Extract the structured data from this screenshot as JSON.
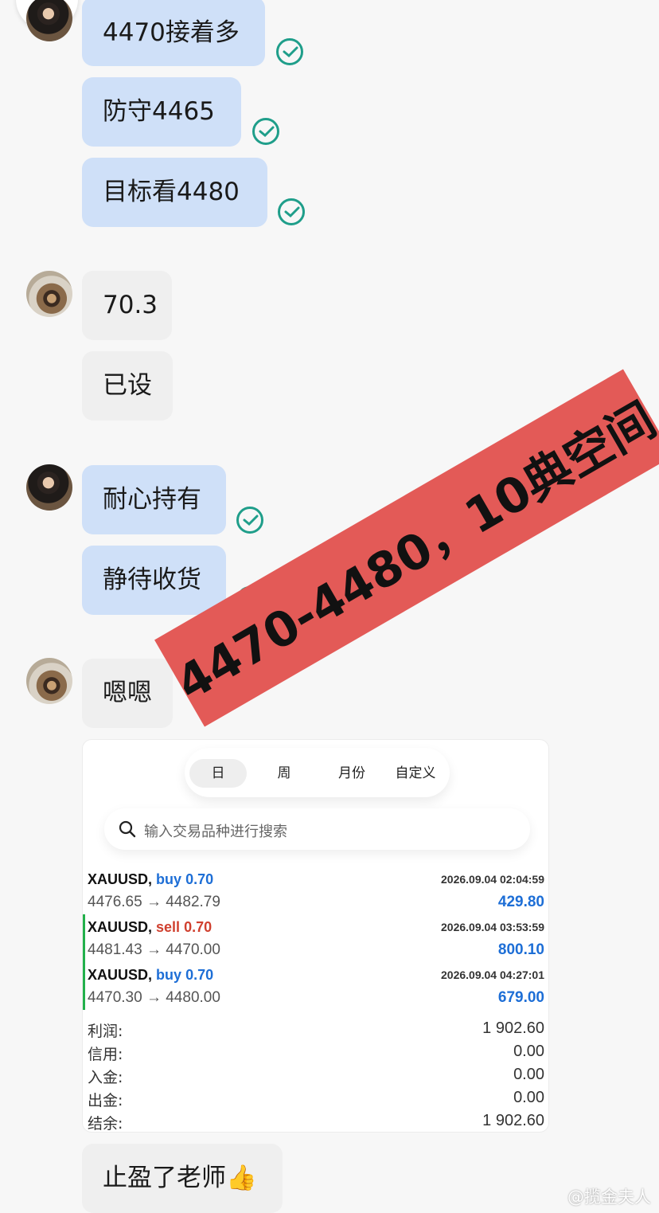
{
  "messages": {
    "m1": "4470接着多",
    "m2": "防守4465",
    "m3": "目标看4480",
    "m4": "70.3",
    "m5": "已设",
    "m6": "耐心持有",
    "m7": "静待收货",
    "m8": "嗯嗯",
    "m9": "止盈了老师👍"
  },
  "stamp_text": "4470-4480，10典空间",
  "trade_card": {
    "tabs": [
      "日",
      "周",
      "月份",
      "自定义"
    ],
    "active_tab": "日",
    "search_placeholder": "输入交易品种进行搜索",
    "trades": [
      {
        "symbol": "XAUUSD,",
        "direction": "buy",
        "lots": "0.70",
        "prices": "4476.65 → 4482.79",
        "time": "2026.09.04 02:04:59",
        "profit": "429.80"
      },
      {
        "symbol": "XAUUSD,",
        "direction": "sell",
        "lots": "0.70",
        "prices": "4481.43 → 4470.00",
        "time": "2026.09.04 03:53:59",
        "profit": "800.10"
      },
      {
        "symbol": "XAUUSD,",
        "direction": "buy",
        "lots": "0.70",
        "prices": "4470.30 → 4480.00",
        "time": "2026.09.04 04:27:01",
        "profit": "679.00"
      }
    ],
    "summary": [
      {
        "label": "利润:",
        "value": "1 902.60"
      },
      {
        "label": "信用:",
        "value": "0.00"
      },
      {
        "label": "入金:",
        "value": "0.00"
      },
      {
        "label": "出金:",
        "value": "0.00"
      },
      {
        "label": "结余:",
        "value": "1 902.60"
      }
    ]
  },
  "watermark": "@揽金夫人",
  "colors": {
    "outgoing_bubble": "#cfe0f8",
    "incoming_bubble": "#efefef",
    "check": "#1f9e8a",
    "stamp": "#e35a57",
    "buy": "#1d6ed6",
    "sell": "#d0402f"
  }
}
